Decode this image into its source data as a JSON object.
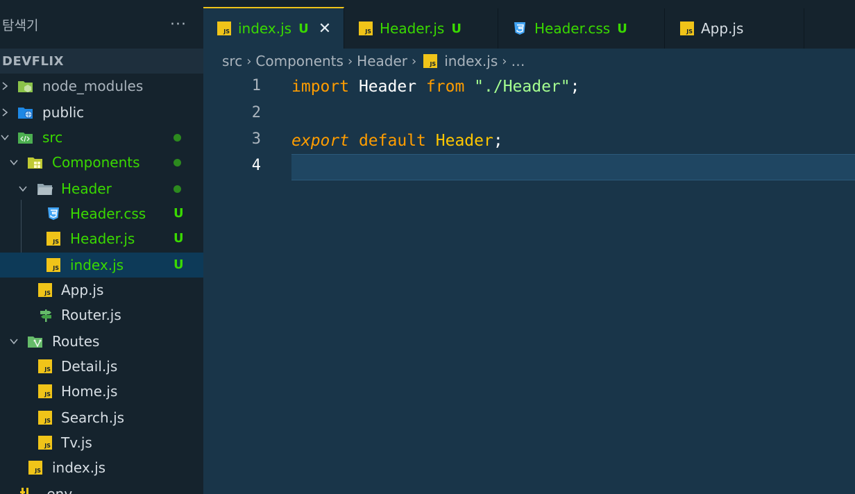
{
  "sidebar": {
    "title": "탐색기",
    "more_label": "···",
    "project": "DEVFLIX",
    "items": [
      {
        "label": "node_modules",
        "badge": ""
      },
      {
        "label": "public",
        "badge": ""
      },
      {
        "label": "src",
        "badge": ""
      },
      {
        "label": "Components",
        "badge": ""
      },
      {
        "label": "Header",
        "badge": ""
      },
      {
        "label": "Header.css",
        "badge": "U"
      },
      {
        "label": "Header.js",
        "badge": "U"
      },
      {
        "label": "index.js",
        "badge": "U"
      },
      {
        "label": "App.js",
        "badge": ""
      },
      {
        "label": "Router.js",
        "badge": ""
      },
      {
        "label": "Routes",
        "badge": ""
      },
      {
        "label": "Detail.js",
        "badge": ""
      },
      {
        "label": "Home.js",
        "badge": ""
      },
      {
        "label": "Search.js",
        "badge": ""
      },
      {
        "label": "Tv.js",
        "badge": ""
      },
      {
        "label": "index.js",
        "badge": ""
      },
      {
        "label": ".env",
        "badge": ""
      }
    ]
  },
  "tabs": [
    {
      "label": "index.js",
      "badge": "U",
      "icon": "js",
      "close": "✕"
    },
    {
      "label": "Header.js",
      "badge": "U",
      "icon": "js"
    },
    {
      "label": "Header.css",
      "badge": "U",
      "icon": "css"
    },
    {
      "label": "App.js",
      "badge": "",
      "icon": "js"
    }
  ],
  "breadcrumb": [
    "src",
    "Components",
    "Header",
    "index.js",
    "…"
  ],
  "editor": {
    "line_numbers": [
      "1",
      "2",
      "3",
      "4"
    ],
    "line1": {
      "kw1": "import",
      "id1": "Header",
      "kw2": "from",
      "str": "\"./Header\"",
      "semi": ";"
    },
    "line3": {
      "kw1": "export",
      "kw2": "default",
      "id1": "Header",
      "semi": ";"
    }
  },
  "colors": {
    "accent": "#f0c419",
    "untracked": "#3ad900",
    "editor_bg": "#193549",
    "sidebar_bg": "#15232d",
    "keyword": "#ff9d00",
    "string": "#a5ff90"
  }
}
